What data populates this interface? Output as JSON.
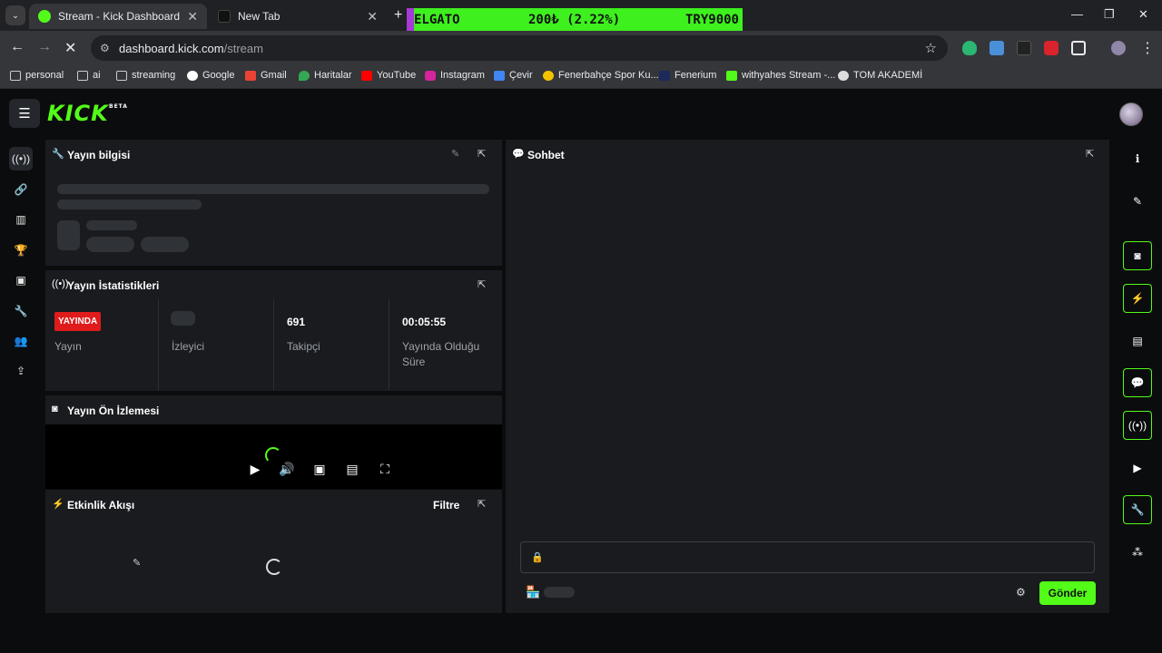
{
  "browser": {
    "tabs": [
      {
        "title": "Stream - Kick Dashboard",
        "favicon_color": "#53fc18"
      },
      {
        "title": "New Tab",
        "favicon_color": "#222222"
      }
    ],
    "ticker": {
      "symbol": "ELGATO",
      "change": "200₺ (2.22%)",
      "pair": "TRY9000",
      "background": "#3ef01d"
    },
    "url_host": "dashboard.kick.com",
    "url_path": "/stream",
    "bookmarks": [
      "personal",
      "ai",
      "streaming",
      "Google",
      "Gmail",
      "Haritalar",
      "YouTube",
      "Instagram",
      "Çevir",
      "Fenerbahçe Spor Ku...",
      "Fenerium",
      "withyahes Stream -...",
      "TOM AKADEMİ"
    ]
  },
  "dashboard": {
    "logo": "KICK",
    "logo_badge": "BETA",
    "accent": "#53fc18",
    "stream_info": {
      "title": "Yayın bilgisi"
    },
    "stream_stats": {
      "title": "Yayın İstatistikleri",
      "live_badge": "YAYINDA",
      "stats": [
        {
          "label": "Yayın"
        },
        {
          "label": "İzleyici"
        },
        {
          "value": "691",
          "label": "Takipçi"
        },
        {
          "value": "00:05:55",
          "label": "Yayında Olduğu Süre"
        }
      ]
    },
    "preview": {
      "title": "Yayın Ön İzlemesi"
    },
    "activity": {
      "title": "Etkinlik Akışı",
      "filter_label": "Filtre"
    },
    "chat": {
      "title": "Sohbet",
      "send_label": "Gönder"
    }
  }
}
